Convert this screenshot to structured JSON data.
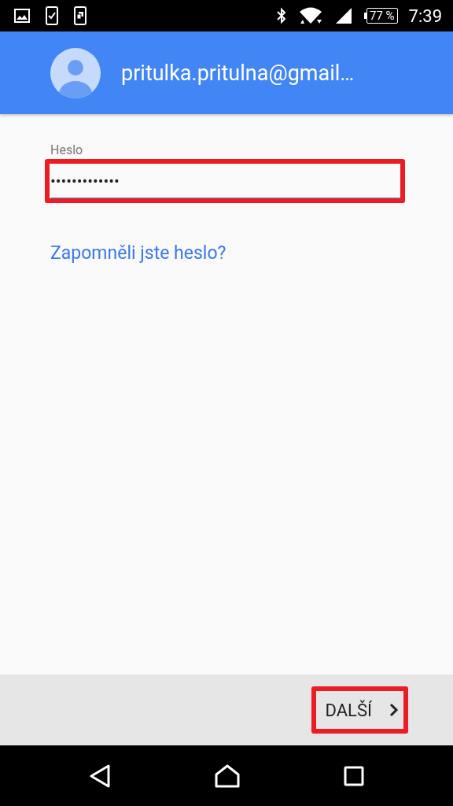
{
  "status_bar": {
    "battery": "77 %",
    "time": "7:39"
  },
  "header": {
    "account": "pritulka.pritulna@gmail…"
  },
  "password": {
    "label": "Heslo",
    "value": "•••••••••••••",
    "highlighted": true
  },
  "forgot_link": "Zapomněli jste heslo?",
  "next_button": {
    "label": "DALŠÍ",
    "highlighted": true
  }
}
